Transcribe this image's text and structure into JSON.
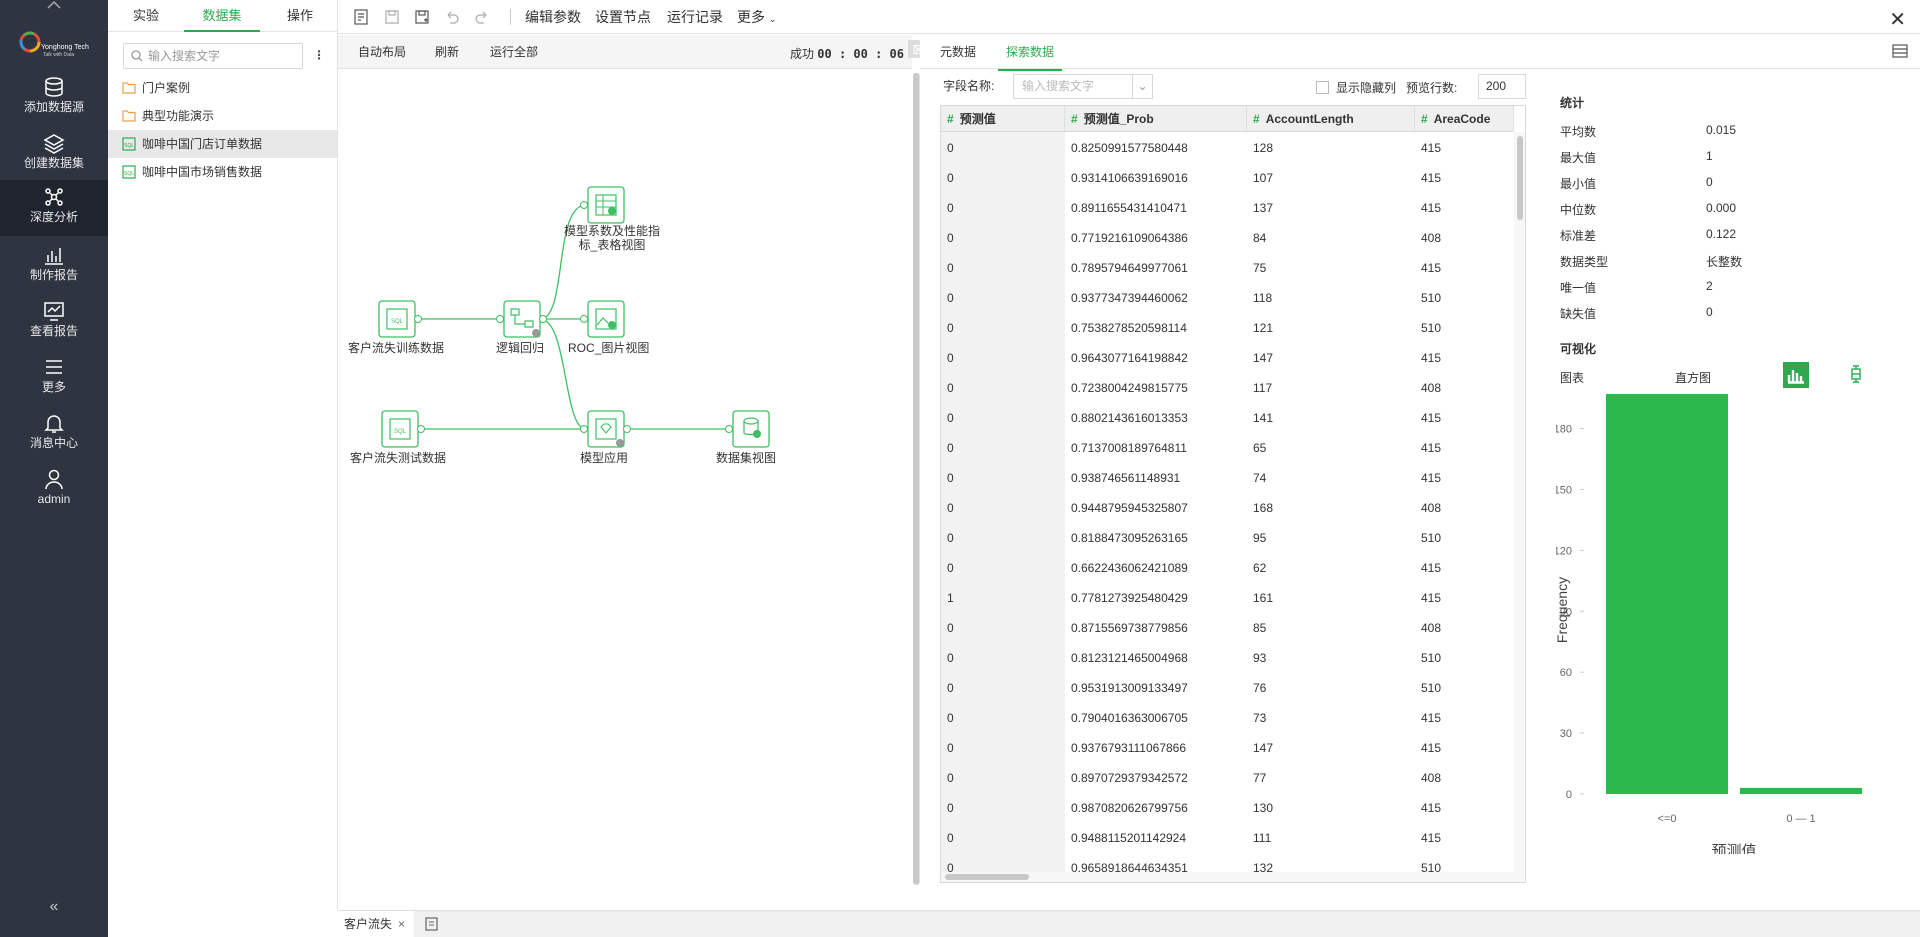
{
  "nav": {
    "logo_text": "Yonghong Tech",
    "logo_sub": "Talk with Data",
    "items": [
      {
        "label": "添加数据源"
      },
      {
        "label": "创建数据集"
      },
      {
        "label": "深度分析"
      },
      {
        "label": "制作报告"
      },
      {
        "label": "查看报告"
      },
      {
        "label": "更多"
      },
      {
        "label": "消息中心"
      },
      {
        "label": "admin"
      }
    ],
    "collapse": "«"
  },
  "left_panel": {
    "tabs": [
      "实验",
      "数据集",
      "操作"
    ],
    "search_placeholder": "输入搜索文字",
    "items": [
      {
        "label": "门户案例",
        "icon": "folder-icon"
      },
      {
        "label": "典型功能演示",
        "icon": "folder-icon"
      },
      {
        "label": "咖啡中国门店订单数据",
        "icon": "sql-icon"
      },
      {
        "label": "咖啡中国市场销售数据",
        "icon": "sql-icon"
      }
    ]
  },
  "toolbar": {
    "edit_params": "编辑参数",
    "set_node": "设置节点",
    "run_log": "运行记录",
    "more": "更多"
  },
  "canvas_bar": {
    "auto_layout": "自动布局",
    "refresh": "刷新",
    "run_all": "运行全部",
    "status": "成功",
    "time": "00 : 00 : 06"
  },
  "nodes": {
    "train": "客户流失训练数据",
    "logistic": "逻辑回归",
    "coef_line1": "模型系数及性能指",
    "coef_line2": "标_表格视图",
    "roc": "ROC_图片视图",
    "test": "客户流失测试数据",
    "apply": "模型应用",
    "dataset_view": "数据集视图"
  },
  "bottom_tab": {
    "label": "客户流失",
    "close": "×"
  },
  "right_tabs": [
    "元数据",
    "探索数据"
  ],
  "filter": {
    "field_label": "字段名称:",
    "field_placeholder": "输入搜索文字",
    "show_hidden": "显示隐藏列",
    "preview_label": "预览行数:",
    "preview_value": "200"
  },
  "table": {
    "columns": [
      "预测值",
      "预测值_Prob",
      "AccountLength",
      "AreaCode"
    ],
    "rows": [
      [
        "0",
        "0.8250991577580448",
        "128",
        "415"
      ],
      [
        "0",
        "0.9314106639169016",
        "107",
        "415"
      ],
      [
        "0",
        "0.8911655431410471",
        "137",
        "415"
      ],
      [
        "0",
        "0.7719216109064386",
        "84",
        "408"
      ],
      [
        "0",
        "0.7895794649977061",
        "75",
        "415"
      ],
      [
        "0",
        "0.9377347394460062",
        "118",
        "510"
      ],
      [
        "0",
        "0.7538278520598114",
        "121",
        "510"
      ],
      [
        "0",
        "0.9643077164198842",
        "147",
        "415"
      ],
      [
        "0",
        "0.7238004249815775",
        "117",
        "408"
      ],
      [
        "0",
        "0.8802143616013353",
        "141",
        "415"
      ],
      [
        "0",
        "0.7137008189764811",
        "65",
        "415"
      ],
      [
        "0",
        "0.938746561148931",
        "74",
        "415"
      ],
      [
        "0",
        "0.9448795945325807",
        "168",
        "408"
      ],
      [
        "0",
        "0.8188473095263165",
        "95",
        "510"
      ],
      [
        "0",
        "0.6622436062421089",
        "62",
        "415"
      ],
      [
        "1",
        "0.7781273925480429",
        "161",
        "415"
      ],
      [
        "0",
        "0.8715569738779856",
        "85",
        "408"
      ],
      [
        "0",
        "0.8123121465004968",
        "93",
        "510"
      ],
      [
        "0",
        "0.9531913009133497",
        "76",
        "510"
      ],
      [
        "0",
        "0.7904016363006705",
        "73",
        "415"
      ],
      [
        "0",
        "0.9376793111067866",
        "147",
        "415"
      ],
      [
        "0",
        "0.8970729379342572",
        "77",
        "408"
      ],
      [
        "0",
        "0.9870820626799756",
        "130",
        "415"
      ],
      [
        "0",
        "0.9488115201142924",
        "111",
        "415"
      ],
      [
        "0",
        "0.9658918644634351",
        "132",
        "510"
      ]
    ]
  },
  "stats": {
    "title": "统计",
    "rows": [
      {
        "label": "平均数",
        "value": "0.015"
      },
      {
        "label": "最大值",
        "value": "1"
      },
      {
        "label": "最小值",
        "value": "0"
      },
      {
        "label": "中位数",
        "value": "0.000"
      },
      {
        "label": "标准差",
        "value": "0.122"
      },
      {
        "label": "数据类型",
        "value": "长整数"
      },
      {
        "label": "唯一值",
        "value": "2"
      },
      {
        "label": "缺失值",
        "value": "0"
      }
    ],
    "viz_title": "可视化",
    "chart_label": "图表",
    "chart_type": "直方图"
  },
  "colors": {
    "accent": "#2fa84f",
    "nav_bg": "#2f3441"
  },
  "chart_data": {
    "type": "bar",
    "categories": [
      "<=0",
      "0 — 1"
    ],
    "values": [
      197,
      3
    ],
    "xlabel": "预测值",
    "ylabel": "Frequency",
    "yticks": [
      0,
      30,
      60,
      90,
      120,
      150,
      180
    ],
    "ylim": [
      0,
      197
    ],
    "color": "#2db84d",
    "grid": false
  }
}
